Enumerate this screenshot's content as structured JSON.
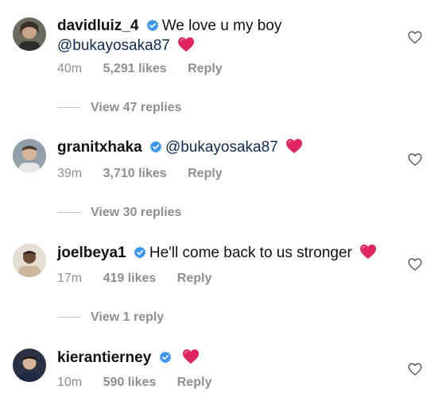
{
  "comments": [
    {
      "username": "davidluiz_4",
      "verified": true,
      "text": "We love u my boy",
      "mention": "@bukayosaka87",
      "emoji": "❤️",
      "time": "40m",
      "likes": "5,291 likes",
      "reply": "Reply",
      "view_replies": "View 47 replies"
    },
    {
      "username": "granitxhaka",
      "verified": true,
      "text": "",
      "mention": "@bukayosaka87",
      "emoji": "❤️",
      "time": "39m",
      "likes": "3,710 likes",
      "reply": "Reply",
      "view_replies": "View 30 replies"
    },
    {
      "username": "joelbeya1",
      "verified": true,
      "text": "He'll come back to us stronger",
      "mention": "",
      "emoji": "❤️",
      "time": "17m",
      "likes": "419 likes",
      "reply": "Reply",
      "view_replies": "View 1 reply"
    },
    {
      "username": "kierantierney",
      "verified": true,
      "text": "",
      "mention": "",
      "emoji": "❤️",
      "time": "10m",
      "likes": "590 likes",
      "reply": "Reply",
      "view_replies": ""
    }
  ],
  "colors": {
    "verified": "#3897f0",
    "heart_emoji": "#e0245e",
    "meta_gray": "#8e8e8e"
  },
  "icons": {
    "verified": "verified-badge-icon",
    "like": "heart-outline-icon",
    "emoji": "red-heart-emoji-icon"
  }
}
